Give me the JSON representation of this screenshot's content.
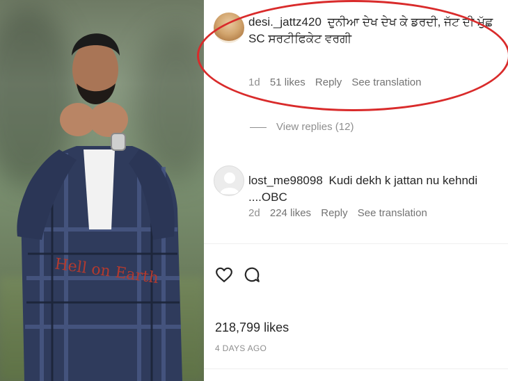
{
  "comments": [
    {
      "username": "desi._jattz420",
      "text": "ਦੁਨੀਆ ਦੇਖ ਦੇਖ ਕੇ ਡਰਦੀ, ਜੱਟ ਦੀ ਮੁੱਛ SC ਸਰਟੀਫਿਕੇਟ ਵਰਗੀ",
      "time": "1d",
      "likes": "51 likes",
      "reply": "Reply",
      "see_translation": "See translation",
      "view_replies": "View replies (12)"
    },
    {
      "username": "lost_me98098",
      "text": "Kudi dekh k jattan nu kehndi ....OBC",
      "time": "2d",
      "likes": "224 likes",
      "reply": "Reply",
      "see_translation": "See translation"
    }
  ],
  "post": {
    "likes": "218,799 likes",
    "time_ago": "4 DAYS AGO"
  },
  "colors": {
    "highlight_ellipse": "#d92b2b",
    "text_primary": "#262626",
    "text_secondary": "#8e8e8e"
  },
  "icons": {
    "like": "heart-icon",
    "comment": "comment-bubble-icon"
  }
}
